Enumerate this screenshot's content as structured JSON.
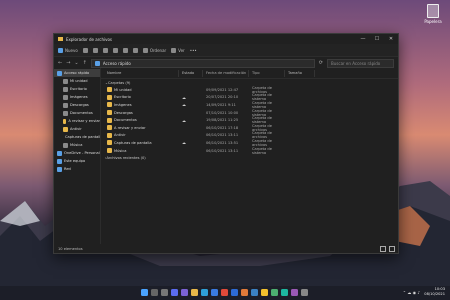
{
  "desktop": {
    "recycle_label": "Papelera"
  },
  "window": {
    "title": "Explorador de archivos",
    "controls": {
      "minimize": "—",
      "maximize": "☐",
      "close": "✕"
    }
  },
  "toolbar": {
    "new_label": "Nuevo",
    "sort_label": "Ordenar",
    "view_label": "Ver",
    "more": "•••"
  },
  "address": {
    "path": "Acceso rápido",
    "search_placeholder": "Buscar en Acceso rápido"
  },
  "sidebar": {
    "items": [
      {
        "label": "Acceso rápido",
        "icon": "star-icon",
        "selected": true,
        "sub": false
      },
      {
        "label": "Mi unidad",
        "icon": "drive-icon",
        "sub": true
      },
      {
        "label": "Escritorio",
        "icon": "desktop-icon",
        "sub": true
      },
      {
        "label": "Imágenes",
        "icon": "pictures-icon",
        "sub": true
      },
      {
        "label": "Descargas",
        "icon": "download-icon",
        "sub": true
      },
      {
        "label": "Documentos",
        "icon": "documents-icon",
        "sub": true
      },
      {
        "label": "A revisar y enviar",
        "icon": "folder-icon",
        "sub": true
      },
      {
        "label": "Antivir",
        "icon": "folder-icon",
        "sub": true
      },
      {
        "label": "Capturas de pantalla",
        "icon": "folder-icon",
        "sub": true
      },
      {
        "label": "Música",
        "icon": "music-icon",
        "sub": true
      },
      {
        "label": "OneDrive - Personal",
        "icon": "cloud-icon",
        "sub": false
      },
      {
        "label": "Este equipo",
        "icon": "computer-icon",
        "sub": false
      },
      {
        "label": "Red",
        "icon": "network-icon",
        "sub": false
      }
    ]
  },
  "columns": {
    "name": "Nombre",
    "status": "Estado",
    "modified": "Fecha de modificación",
    "type": "Tipo",
    "size": "Tamaño"
  },
  "groups": {
    "frequent": "Carpetas (9)",
    "recent": "Archivos recientes (0)"
  },
  "rows": [
    {
      "name": "Mi unidad",
      "status": "",
      "date": "09/09/2021 12:47",
      "type": "Carpeta de archivos"
    },
    {
      "name": "Escritorio",
      "status": "☁",
      "date": "20/07/2021 20:10",
      "type": "Carpeta de sistema"
    },
    {
      "name": "Imágenes",
      "status": "☁",
      "date": "14/09/2021 9:11",
      "type": "Carpeta de sistema"
    },
    {
      "name": "Descargas",
      "status": "",
      "date": "07/10/2021 10:00",
      "type": "Carpeta de sistema"
    },
    {
      "name": "Documentos",
      "status": "☁",
      "date": "19/08/2021 11:25",
      "type": "Carpeta de sistema"
    },
    {
      "name": "A revisar y enviar",
      "status": "",
      "date": "06/10/2021 17:18",
      "type": "Carpeta de archivos"
    },
    {
      "name": "Antivir",
      "status": "",
      "date": "06/10/2021 13:11",
      "type": "Carpeta de archivos"
    },
    {
      "name": "Capturas de pantalla",
      "status": "☁",
      "date": "06/10/2021 13:51",
      "type": "Carpeta de archivos"
    },
    {
      "name": "Música",
      "status": "",
      "date": "06/10/2021 13:11",
      "type": "Carpeta de sistema"
    }
  ],
  "status": {
    "items": "10 elementos"
  },
  "tray": {
    "time": "10:03",
    "date": "08/10/2021"
  }
}
